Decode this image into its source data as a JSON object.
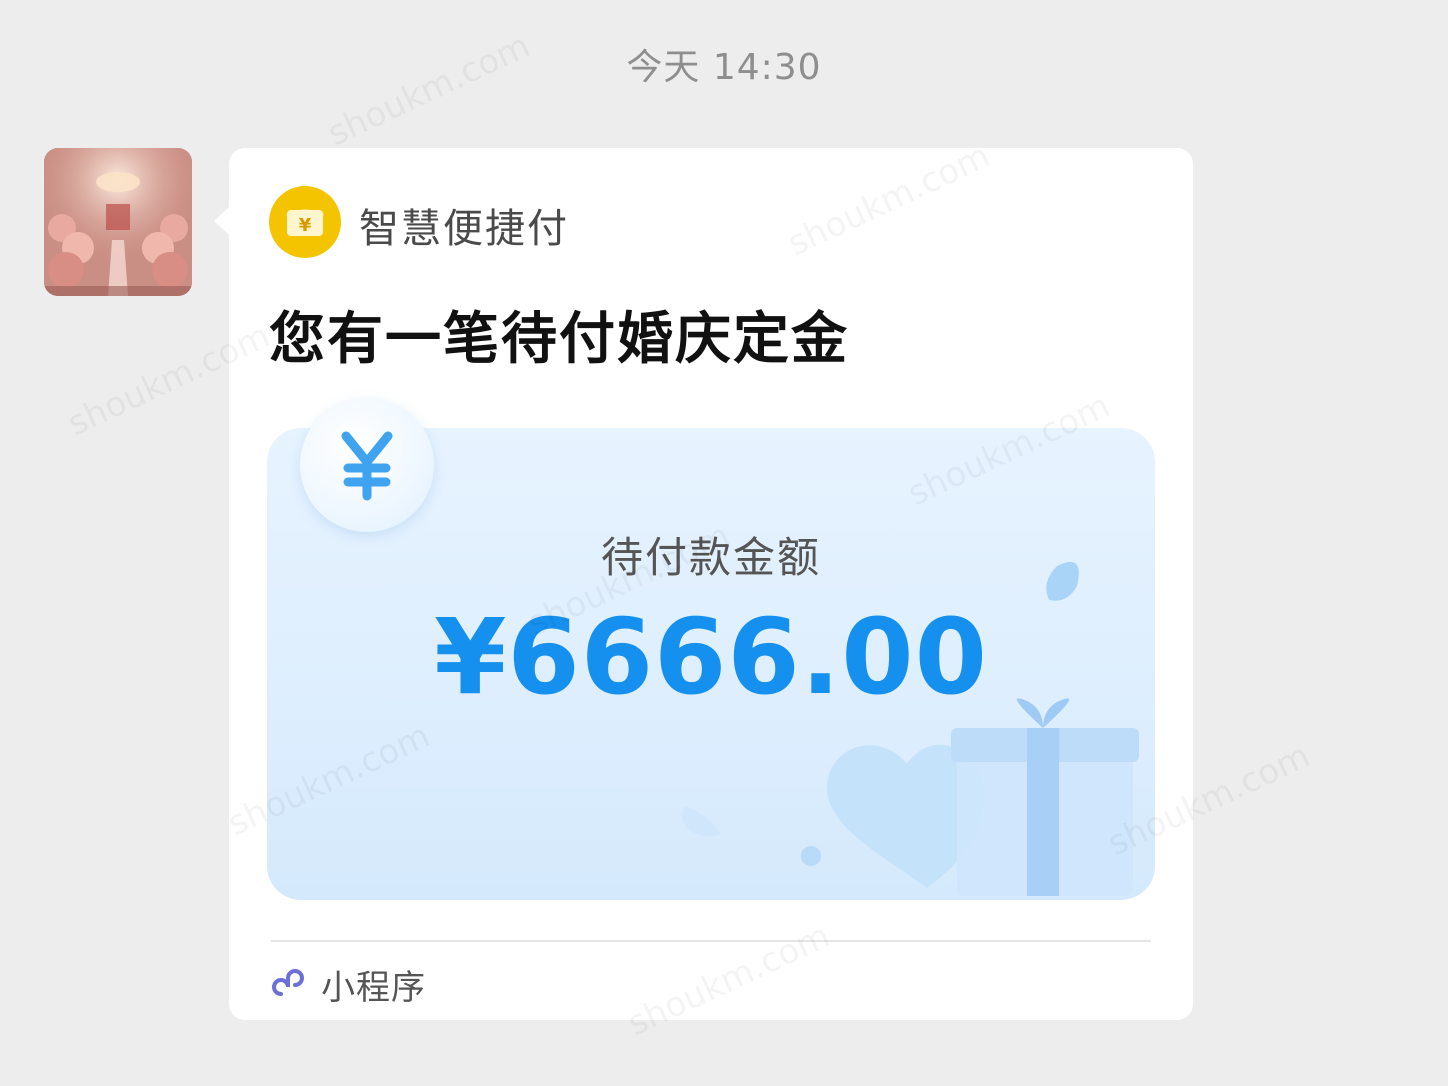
{
  "chat": {
    "timestamp": "今天 14:30"
  },
  "message": {
    "sender_avatar_icon": "wedding-hall-photo",
    "app_logo_icon": "yen-wallet-icon",
    "app_name": "智慧便捷付",
    "headline": "您有一笔待付婚庆定金",
    "card": {
      "badge_icon": "yen-icon",
      "label": "待付款金额",
      "amount": "¥6666.00",
      "decor_icons": [
        "heart-icon",
        "gift-box-icon",
        "petal-icon"
      ]
    },
    "footer": {
      "icon": "mini-program-icon",
      "label": "小程序"
    }
  },
  "colors": {
    "background": "#ededed",
    "bubble": "#ffffff",
    "accent_blue": "#1590ee",
    "logo_yellow": "#f5c400"
  }
}
